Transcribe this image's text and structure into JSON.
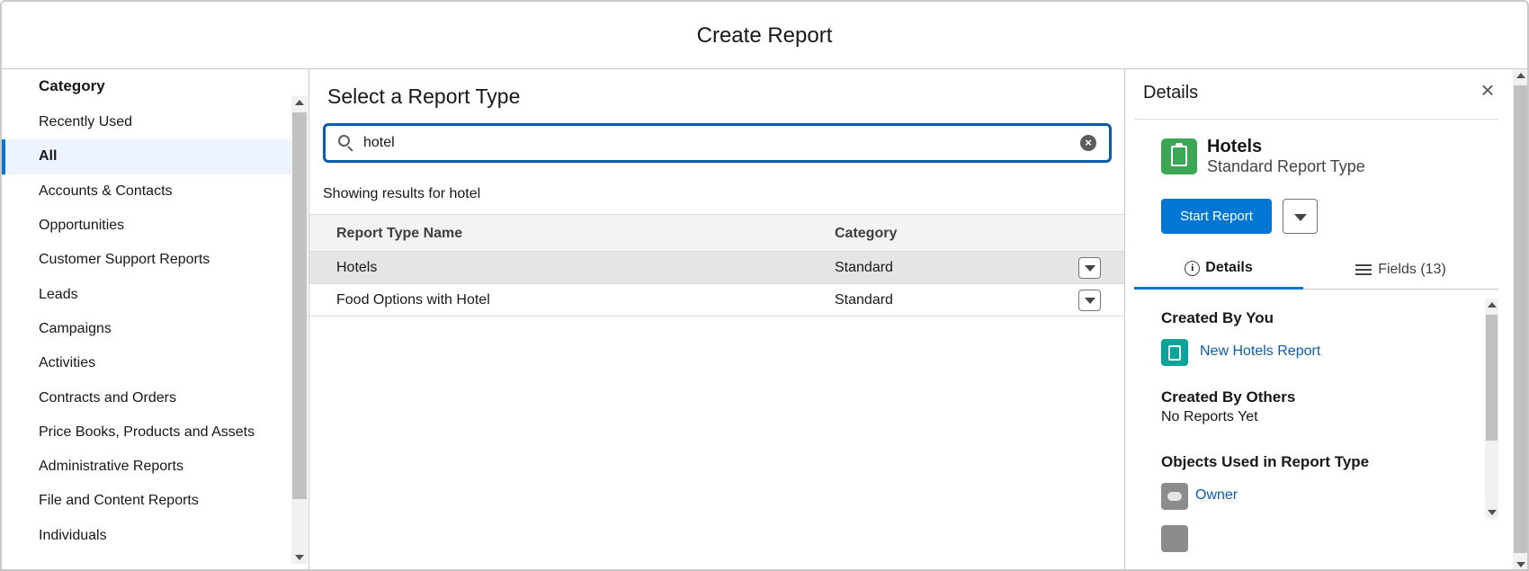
{
  "modal": {
    "title": "Create Report"
  },
  "sidebar": {
    "heading": "Category",
    "items": [
      {
        "label": "Recently Used"
      },
      {
        "label": "All"
      },
      {
        "label": "Accounts & Contacts"
      },
      {
        "label": "Opportunities"
      },
      {
        "label": "Customer Support Reports"
      },
      {
        "label": "Leads"
      },
      {
        "label": "Campaigns"
      },
      {
        "label": "Activities"
      },
      {
        "label": "Contracts and Orders"
      },
      {
        "label": "Price Books, Products and Assets"
      },
      {
        "label": "Administrative Reports"
      },
      {
        "label": "File and Content Reports"
      },
      {
        "label": "Individuals"
      }
    ],
    "active_index": 1
  },
  "main": {
    "heading": "Select a Report Type",
    "search": {
      "value": "hotel",
      "placeholder": ""
    },
    "results_note": "Showing results for hotel",
    "columns": [
      "Report Type Name",
      "Category"
    ],
    "rows": [
      {
        "name": "Hotels",
        "category": "Standard",
        "selected": true
      },
      {
        "name": "Food Options with Hotel",
        "category": "Standard",
        "selected": false
      }
    ]
  },
  "details": {
    "title": "Details",
    "report_type_name": "Hotels",
    "report_type_sub": "Standard Report Type",
    "start_button": "Start Report",
    "tabs": {
      "details": "Details",
      "fields": "Fields (13)"
    },
    "created_by_you_heading": "Created By You",
    "created_by_you_report": "New Hotels Report",
    "created_by_others_heading": "Created By Others",
    "created_by_others_text": "No Reports Yet",
    "objects_heading": "Objects Used in Report Type",
    "objects": [
      "Owner"
    ]
  },
  "colors": {
    "brand": "#0176d3",
    "report_type_icon": "#3ba755",
    "report_icon": "#06a59a",
    "link": "#0b5cab"
  }
}
